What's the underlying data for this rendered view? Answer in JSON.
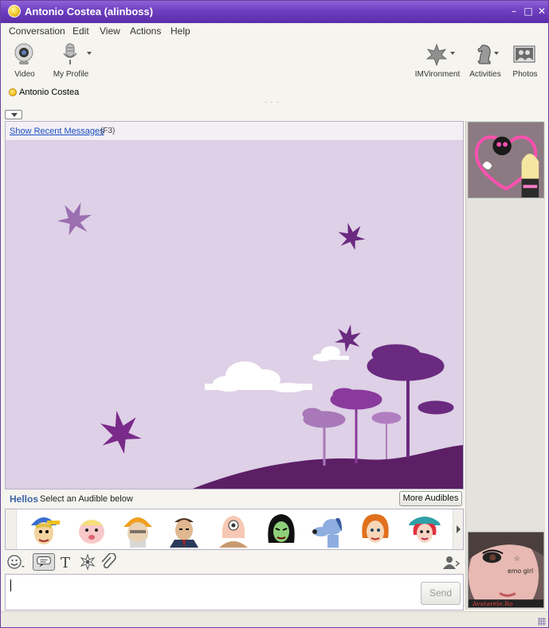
{
  "window": {
    "title": "Antonio Costea (alinboss)",
    "controls": [
      "minimize",
      "maximize",
      "close"
    ]
  },
  "menu": [
    "Conversation",
    "Edit",
    "View",
    "Actions",
    "Help"
  ],
  "toolbar": {
    "left": [
      {
        "label": "Video",
        "icon": "webcam-icon"
      },
      {
        "label": "My Profile",
        "icon": "microphone-icon",
        "dropdown": true
      }
    ],
    "right": [
      {
        "label": "IMVironment",
        "icon": "leaves-icon",
        "dropdown": true
      },
      {
        "label": "Activities",
        "icon": "chess-knight-icon",
        "dropdown": true
      },
      {
        "label": "Photos",
        "icon": "photos-icon"
      }
    ]
  },
  "contact": {
    "name": "Antonio Costea",
    "status_color": "#f0b000"
  },
  "chat": {
    "recent_link": "Show Recent Messages",
    "recent_shortcut": "(F3)",
    "background_theme": "purple leaves and trees",
    "accent": "#6e3ec0"
  },
  "audibles": {
    "title": "Hellos",
    "hint": "Select an Audible below",
    "more_label": "More Audibles",
    "faces": [
      "cap-boy",
      "pink-baby",
      "orange-hat-man",
      "suit-man",
      "cyclops",
      "green-witch",
      "blue-dog",
      "redhead-woman",
      "teal-hat-woman"
    ]
  },
  "format_tools": [
    "smiley-icon",
    "nudge-icon",
    "text-format-icon",
    "sparkle-icon",
    "paperclip-icon"
  ],
  "input": {
    "send_label": "Send"
  },
  "avatar_bottom": {
    "watermark": "Avatarele.Ro",
    "caption": "emo girl"
  }
}
